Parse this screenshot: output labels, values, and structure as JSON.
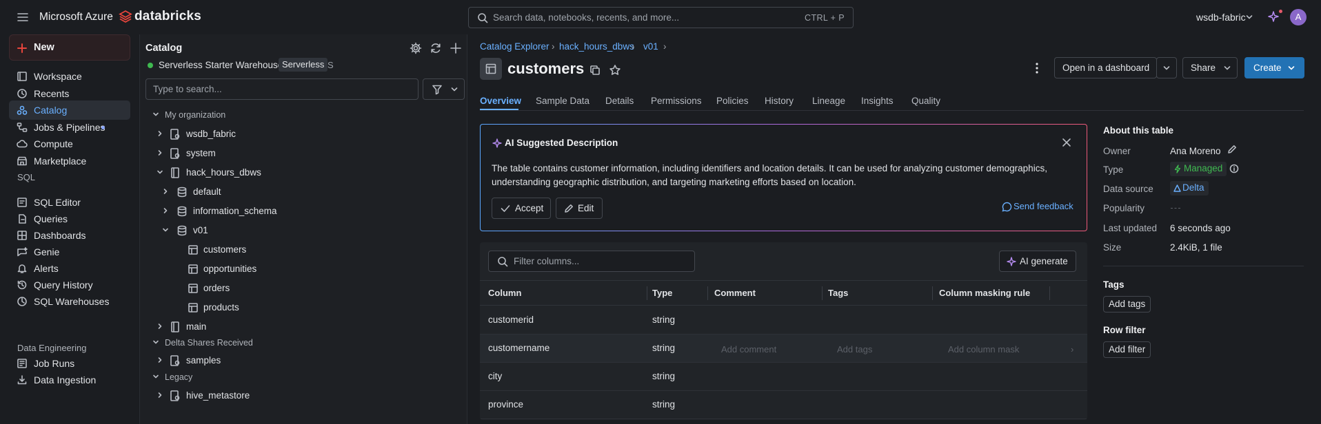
{
  "topbar": {
    "brand": "Microsoft Azure",
    "product": "databricks",
    "search_placeholder": "Search data, notebooks, recents, and more...",
    "search_shortcut": "CTRL + P",
    "workspace": "wsdb-fabric",
    "avatar_letter": "A"
  },
  "nav": {
    "new_label": "New",
    "items": [
      {
        "label": "Workspace",
        "icon": "folder-icon"
      },
      {
        "label": "Recents",
        "icon": "clock-icon"
      },
      {
        "label": "Catalog",
        "icon": "catalog-icon",
        "active": true
      },
      {
        "label": "Jobs & Pipelines",
        "icon": "workflow-icon"
      },
      {
        "label": "Compute",
        "icon": "cloud-icon"
      },
      {
        "label": "Marketplace",
        "icon": "store-icon"
      }
    ],
    "sql_section": "SQL",
    "sql_items": [
      {
        "label": "SQL Editor",
        "icon": "editor-icon"
      },
      {
        "label": "Queries",
        "icon": "query-icon"
      },
      {
        "label": "Dashboards",
        "icon": "dashboard-icon"
      },
      {
        "label": "Genie",
        "icon": "genie-icon"
      },
      {
        "label": "Alerts",
        "icon": "bell-icon"
      },
      {
        "label": "Query History",
        "icon": "history-icon"
      },
      {
        "label": "SQL Warehouses",
        "icon": "warehouse-icon"
      }
    ],
    "de_section": "Data Engineering",
    "de_items": [
      {
        "label": "Job Runs",
        "icon": "job-runs-icon"
      },
      {
        "label": "Data Ingestion",
        "icon": "ingestion-icon"
      }
    ]
  },
  "catalog": {
    "title": "Catalog",
    "warehouse_name": "Serverless Starter Warehouse",
    "warehouse_badge": "Serverless",
    "warehouse_size": "S",
    "search_placeholder": "Type to search...",
    "sections": {
      "org": "My organization",
      "delta": "Delta Shares Received",
      "legacy": "Legacy"
    },
    "tree": {
      "wsdb_fabric": "wsdb_fabric",
      "system": "system",
      "hack_hours_dbws": "hack_hours_dbws",
      "default": "default",
      "information_schema": "information_schema",
      "v01": "v01",
      "customers": "customers",
      "opportunities": "opportunities",
      "orders": "orders",
      "products": "products",
      "main": "main",
      "samples": "samples",
      "hive_metastore": "hive_metastore"
    }
  },
  "breadcrumb": {
    "root": "Catalog Explorer",
    "catalog": "hack_hours_dbws",
    "schema": "v01"
  },
  "header": {
    "title": "customers",
    "open_dashboard": "Open in a dashboard",
    "share": "Share",
    "create": "Create"
  },
  "tabs": [
    "Overview",
    "Sample Data",
    "Details",
    "Permissions",
    "Policies",
    "History",
    "Lineage",
    "Insights",
    "Quality"
  ],
  "ai_card": {
    "title": "AI Suggested Description",
    "text": "The table contains customer information, including identifiers and location details. It can be used for analyzing customer demographics, understanding geographic distribution, and targeting marketing efforts based on location.",
    "accept": "Accept",
    "edit": "Edit",
    "feedback": "Send feedback"
  },
  "columns": {
    "filter_placeholder": "Filter columns...",
    "ai_generate": "AI generate",
    "headers": [
      "Column",
      "Type",
      "Comment",
      "Tags",
      "Column masking rule"
    ],
    "rows": [
      {
        "name": "customerid",
        "type": "string"
      },
      {
        "name": "customername",
        "type": "string"
      },
      {
        "name": "city",
        "type": "string"
      },
      {
        "name": "province",
        "type": "string"
      }
    ],
    "hover_placeholders": {
      "comment": "Add comment",
      "tags": "Add tags",
      "mask": "Add column mask"
    }
  },
  "about": {
    "title": "About this table",
    "owner_label": "Owner",
    "owner": "Ana Moreno",
    "type_label": "Type",
    "type": "Managed",
    "source_label": "Data source",
    "source": "Delta",
    "popularity_label": "Popularity",
    "updated_label": "Last updated",
    "updated": "6 seconds ago",
    "size_label": "Size",
    "size": "2.4KiB, 1 file",
    "tags_title": "Tags",
    "add_tags": "Add tags",
    "row_filter_title": "Row filter",
    "add_filter": "Add filter"
  },
  "colors": {
    "accent": "#6ab0ff",
    "primary_button": "#2272b4",
    "brand_red": "#e8453c",
    "managed_green": "#3fb950"
  }
}
